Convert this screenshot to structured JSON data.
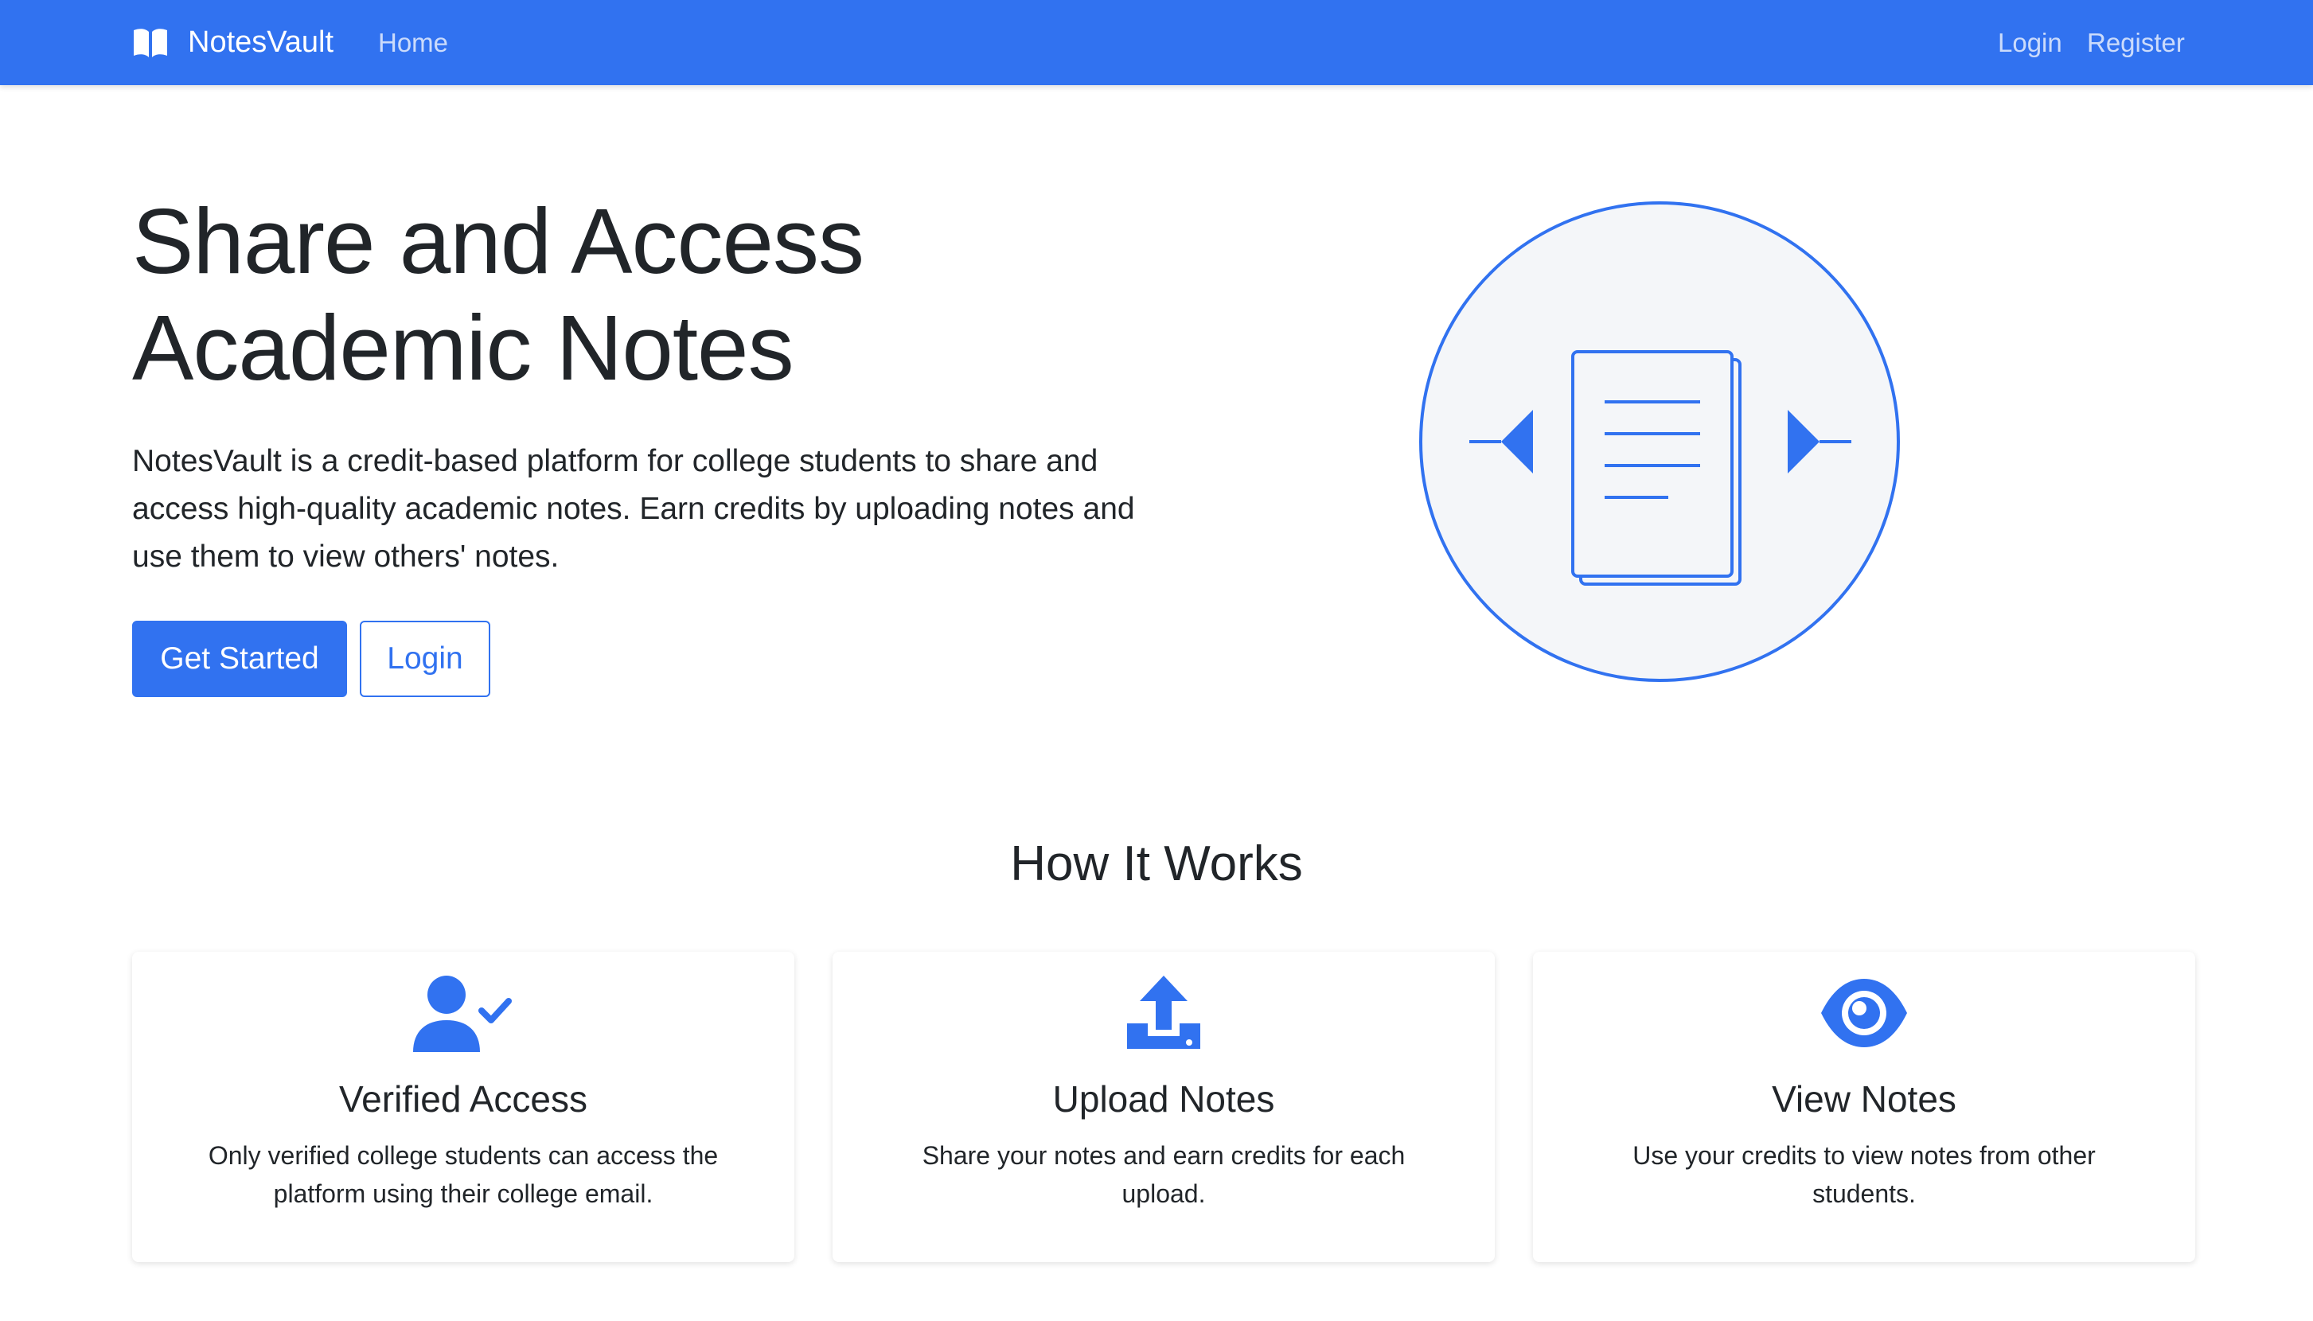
{
  "nav": {
    "brand": "NotesVault",
    "home": "Home",
    "login": "Login",
    "register": "Register"
  },
  "hero": {
    "title_line1": "Share and Access",
    "title_line2": "Academic Notes",
    "description": "NotesVault is a credit-based platform for college students to share and access high-quality academic notes. Earn credits by uploading notes and use them to view others' notes.",
    "primary_button": "Get Started",
    "secondary_button": "Login"
  },
  "how_it_works": {
    "title": "How It Works",
    "cards": [
      {
        "icon": "user-check-icon",
        "title": "Verified Access",
        "text": "Only verified college students can access the platform using their college email."
      },
      {
        "icon": "upload-icon",
        "title": "Upload Notes",
        "text": "Share your notes and earn credits for each upload."
      },
      {
        "icon": "eye-icon",
        "title": "View Notes",
        "text": "Use your credits to view notes from other students."
      }
    ]
  },
  "colors": {
    "primary": "#3172f0",
    "text": "#212529",
    "illustration_bg": "#f4f6f9"
  }
}
